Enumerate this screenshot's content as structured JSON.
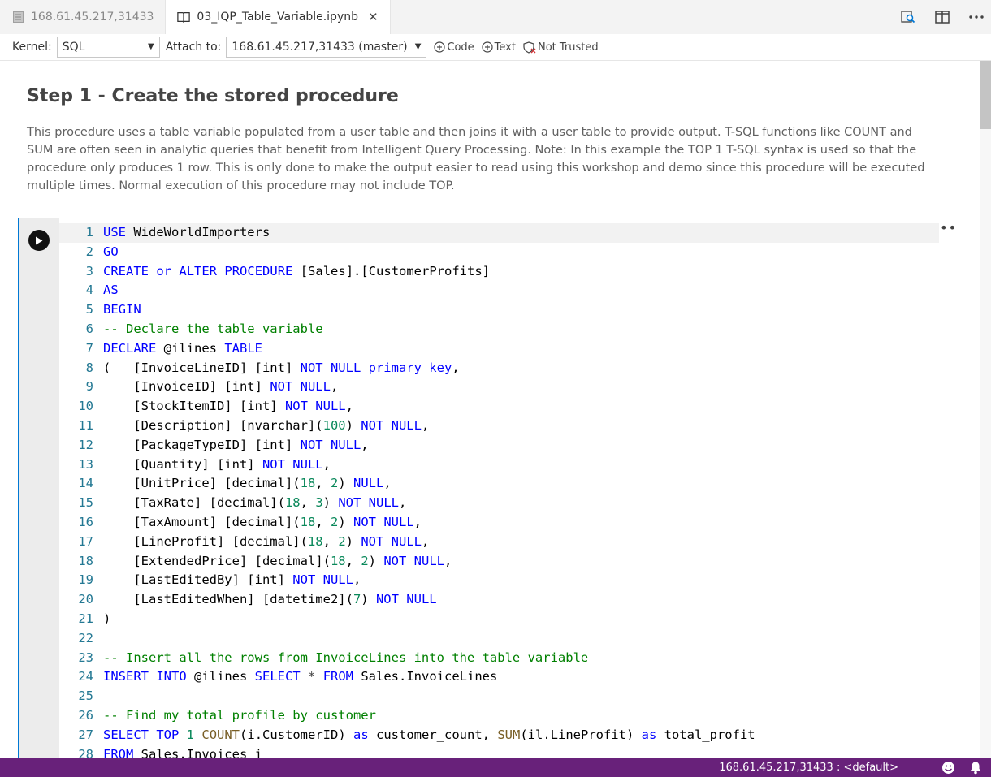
{
  "tabs": [
    {
      "label": "168.61.45.217,31433",
      "icon": "server-icon",
      "active": false
    },
    {
      "label": "03_IQP_Table_Variable.ipynb",
      "icon": "notebook-icon",
      "active": true,
      "close": "✕"
    }
  ],
  "toolbar": {
    "kernel_label": "Kernel:",
    "kernel_value": "SQL",
    "attach_label": "Attach to:",
    "attach_value": "168.61.45.217,31433 (master)",
    "code_label": "Code",
    "text_label": "Text",
    "trusted_label": "Not Trusted"
  },
  "markdown": {
    "title": "Step 1 - Create the stored procedure",
    "paragraph": "This procedure uses a table variable populated from a user table and then joins it with a user table to provide output. T-SQL functions like COUNT and SUM are often seen in analytic queries that benefit from Intelligent Query Processing. Note: In this example the TOP 1 T-SQL syntax is used so that the procedure only produces 1 row. This is only done to make the output easier to read using this workshop and demo since this procedure will be executed multiple times. Normal execution of this procedure may not include TOP."
  },
  "cell": {
    "more_label": "•••",
    "lines": [
      [
        [
          "k",
          "USE"
        ],
        [
          "t",
          " WideWorldImporters"
        ]
      ],
      [
        [
          "k",
          "GO"
        ]
      ],
      [
        [
          "k",
          "CREATE"
        ],
        [
          "t",
          " "
        ],
        [
          "k",
          "or"
        ],
        [
          "t",
          " "
        ],
        [
          "k",
          "ALTER"
        ],
        [
          "t",
          " "
        ],
        [
          "k",
          "PROCEDURE"
        ],
        [
          "t",
          " [Sales].[CustomerProfits]"
        ]
      ],
      [
        [
          "k",
          "AS"
        ]
      ],
      [
        [
          "k",
          "BEGIN"
        ]
      ],
      [
        [
          "c",
          "-- Declare the table variable"
        ]
      ],
      [
        [
          "k",
          "DECLARE"
        ],
        [
          "t",
          " @ilines "
        ],
        [
          "k",
          "TABLE"
        ]
      ],
      [
        [
          "t",
          "(   [InvoiceLineID] [int] "
        ],
        [
          "k",
          "NOT NULL primary key"
        ],
        [
          "t",
          ","
        ]
      ],
      [
        [
          "t",
          "    [InvoiceID] [int] "
        ],
        [
          "k",
          "NOT NULL"
        ],
        [
          "t",
          ","
        ]
      ],
      [
        [
          "t",
          "    [StockItemID] [int] "
        ],
        [
          "k",
          "NOT NULL"
        ],
        [
          "t",
          ","
        ]
      ],
      [
        [
          "t",
          "    [Description] [nvarchar]("
        ],
        [
          "n",
          "100"
        ],
        [
          "t",
          ") "
        ],
        [
          "k",
          "NOT NULL"
        ],
        [
          "t",
          ","
        ]
      ],
      [
        [
          "t",
          "    [PackageTypeID] [int] "
        ],
        [
          "k",
          "NOT NULL"
        ],
        [
          "t",
          ","
        ]
      ],
      [
        [
          "t",
          "    [Quantity] [int] "
        ],
        [
          "k",
          "NOT NULL"
        ],
        [
          "t",
          ","
        ]
      ],
      [
        [
          "t",
          "    [UnitPrice] [decimal]("
        ],
        [
          "n",
          "18"
        ],
        [
          "t",
          ", "
        ],
        [
          "n",
          "2"
        ],
        [
          "t",
          ") "
        ],
        [
          "k",
          "NULL"
        ],
        [
          "t",
          ","
        ]
      ],
      [
        [
          "t",
          "    [TaxRate] [decimal]("
        ],
        [
          "n",
          "18"
        ],
        [
          "t",
          ", "
        ],
        [
          "n",
          "3"
        ],
        [
          "t",
          ") "
        ],
        [
          "k",
          "NOT NULL"
        ],
        [
          "t",
          ","
        ]
      ],
      [
        [
          "t",
          "    [TaxAmount] [decimal]("
        ],
        [
          "n",
          "18"
        ],
        [
          "t",
          ", "
        ],
        [
          "n",
          "2"
        ],
        [
          "t",
          ") "
        ],
        [
          "k",
          "NOT NULL"
        ],
        [
          "t",
          ","
        ]
      ],
      [
        [
          "t",
          "    [LineProfit] [decimal]("
        ],
        [
          "n",
          "18"
        ],
        [
          "t",
          ", "
        ],
        [
          "n",
          "2"
        ],
        [
          "t",
          ") "
        ],
        [
          "k",
          "NOT NULL"
        ],
        [
          "t",
          ","
        ]
      ],
      [
        [
          "t",
          "    [ExtendedPrice] [decimal]("
        ],
        [
          "n",
          "18"
        ],
        [
          "t",
          ", "
        ],
        [
          "n",
          "2"
        ],
        [
          "t",
          ") "
        ],
        [
          "k",
          "NOT NULL"
        ],
        [
          "t",
          ","
        ]
      ],
      [
        [
          "t",
          "    [LastEditedBy] [int] "
        ],
        [
          "k",
          "NOT NULL"
        ],
        [
          "t",
          ","
        ]
      ],
      [
        [
          "t",
          "    [LastEditedWhen] [datetime2]("
        ],
        [
          "n",
          "7"
        ],
        [
          "t",
          ") "
        ],
        [
          "k",
          "NOT NULL"
        ]
      ],
      [
        [
          "t",
          ")"
        ]
      ],
      [],
      [
        [
          "c",
          "-- Insert all the rows from InvoiceLines into the table variable"
        ]
      ],
      [
        [
          "k",
          "INSERT INTO"
        ],
        [
          "t",
          " @ilines "
        ],
        [
          "k",
          "SELECT"
        ],
        [
          "t",
          " "
        ],
        [
          "g",
          "*"
        ],
        [
          "t",
          " "
        ],
        [
          "k",
          "FROM"
        ],
        [
          "t",
          " Sales.InvoiceLines"
        ]
      ],
      [],
      [
        [
          "c",
          "-- Find my total profile by customer"
        ]
      ],
      [
        [
          "k",
          "SELECT TOP"
        ],
        [
          "t",
          " "
        ],
        [
          "n",
          "1"
        ],
        [
          "t",
          " "
        ],
        [
          "f",
          "COUNT"
        ],
        [
          "t",
          "(i.CustomerID) "
        ],
        [
          "k",
          "as"
        ],
        [
          "t",
          " customer_count, "
        ],
        [
          "f",
          "SUM"
        ],
        [
          "t",
          "(il.LineProfit) "
        ],
        [
          "k",
          "as"
        ],
        [
          "t",
          " total_profit"
        ]
      ],
      [
        [
          "k",
          "FROM"
        ],
        [
          "t",
          " Sales.Invoices i"
        ]
      ]
    ]
  },
  "status": {
    "connection": "168.61.45.217,31433 : <default>",
    "icons": [
      "smiley-icon",
      "bell-icon"
    ]
  },
  "colors": {
    "statusbar": "#68217a",
    "cell_border": "#0078d4",
    "keyword": "#0000ff",
    "comment": "#008000",
    "number": "#09885a",
    "function": "#795e26",
    "line_number": "#237893"
  }
}
